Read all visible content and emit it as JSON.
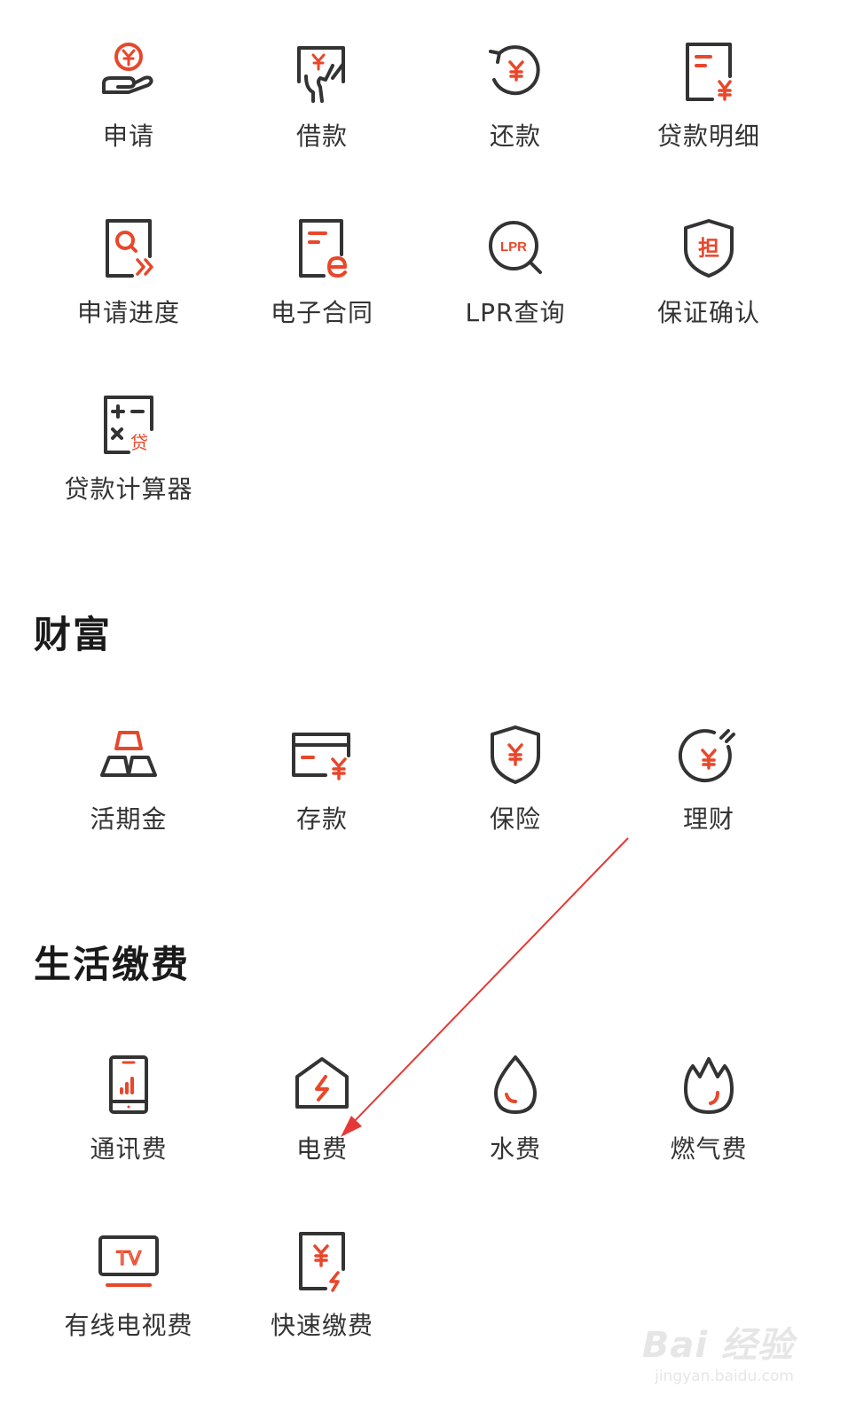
{
  "loan": {
    "items": [
      {
        "label": "申请"
      },
      {
        "label": "借款"
      },
      {
        "label": "还款"
      },
      {
        "label": "贷款明细"
      },
      {
        "label": "申请进度"
      },
      {
        "label": "电子合同"
      },
      {
        "label": "LPR查询"
      },
      {
        "label": "保证确认"
      },
      {
        "label": "贷款计算器"
      }
    ]
  },
  "wealth": {
    "title": "财富",
    "items": [
      {
        "label": "活期金"
      },
      {
        "label": "存款"
      },
      {
        "label": "保险"
      },
      {
        "label": "理财"
      }
    ]
  },
  "life": {
    "title": "生活缴费",
    "items": [
      {
        "label": "通讯费"
      },
      {
        "label": "电费"
      },
      {
        "label": "水费"
      },
      {
        "label": "燃气费"
      },
      {
        "label": "有线电视费"
      },
      {
        "label": "快速缴费"
      }
    ]
  },
  "icons": {
    "lpr_text": "LPR",
    "guarantee_char": "担",
    "calculator_char": "贷",
    "tv_text": "TV"
  },
  "watermark": {
    "logo": "Bai 经验",
    "url": "jingyan.baidu.com"
  },
  "colors": {
    "icon_dark": "#333333",
    "icon_accent": "#e8472b",
    "annotation_arrow": "#e53935"
  }
}
